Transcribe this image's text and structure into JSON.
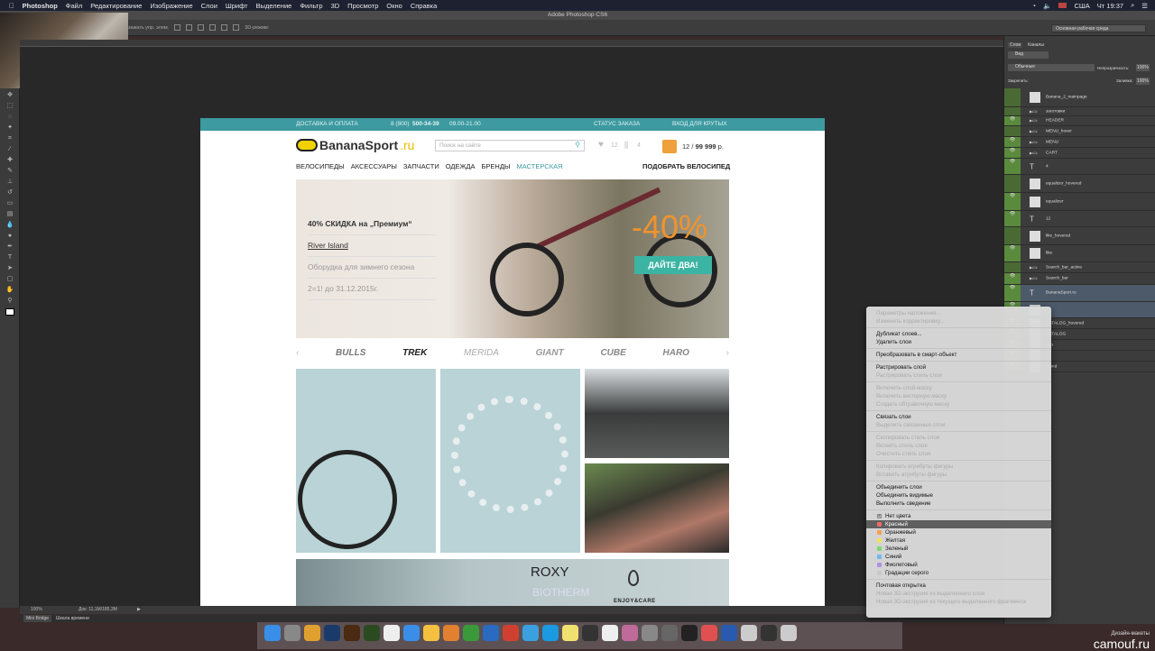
{
  "menubar": {
    "app": "Photoshop",
    "items": [
      "Файл",
      "Редактирование",
      "Изображение",
      "Слои",
      "Шрифт",
      "Выделение",
      "Фильтр",
      "3D",
      "Просмотр",
      "Окно",
      "Справка"
    ],
    "region": "США",
    "clock": "Чт 19:37"
  },
  "window": {
    "title": "Adobe Photoshop CS6",
    "workspace": "Основная рабочая среда",
    "options_label": "зажать упр. элем.",
    "options_3d": "3D-режим:"
  },
  "status": {
    "zoom": "100%",
    "doc": "Док: 11,1M/185,3M",
    "minibridge": "Mini Bridge",
    "timeline": "Шкала времени"
  },
  "site": {
    "topbar": {
      "delivery": "ДОСТАВКА И ОПЛАТА",
      "phone_prefix": "8 (800)",
      "phone": "500-34-39",
      "hours": "09.00-21.00",
      "order_status": "СТАТУС ЗАКАЗА",
      "login": "ВХОД ДЛЯ КРУТЫХ"
    },
    "logo": {
      "name": "BananaSport",
      "tld": ".ru"
    },
    "search_placeholder": "Поиск на сайте",
    "likes": "12",
    "compare": "4",
    "cart": {
      "count": "12",
      "sep": " / ",
      "sum": "99 999",
      "cur": " р."
    },
    "nav": [
      "ВЕЛОСИПЕДЫ",
      "АКСЕССУАРЫ",
      "ЗАПЧАСТИ",
      "ОДЕЖДА",
      "БРЕНДЫ",
      "МАСТЕРСКАЯ"
    ],
    "pick_bike": "ПОДОБРАТЬ ВЕЛОСИПЕД",
    "hero": {
      "items": [
        "40% СКИДКА на „Премиум“",
        "River Island",
        "Оборудка для зимнего сезона",
        "2=1! до 31.12.2015г."
      ],
      "discount": "-40%",
      "cta": "ДАЙТЕ ДВА!"
    },
    "brands": [
      "BULLS",
      "TREK",
      "MERIDA",
      "GIANT",
      "CUBE",
      "HARO"
    ],
    "banner": {
      "brand1": "ROXY",
      "brand2": "BIOTHERM",
      "brand3": "ENJOY&CARE"
    }
  },
  "layers_panel": {
    "tabs": [
      "Слои",
      "Каналы"
    ],
    "filter": "Вид",
    "blend": "Обычные",
    "opacity_label": "Непрозрачность:",
    "opacity": "100%",
    "lock_label": "Закрепить:",
    "fill_label": "Заливка:",
    "fill": "100%",
    "layers": [
      "Banana_2_mainpage",
      "заготовки",
      "HEADER",
      "MENU_hover",
      "MENU",
      "CART",
      "4",
      "equalizer_hovered",
      "equalizer",
      "12",
      "like_hovered",
      "like",
      "Search_bar_active",
      "Search_bar",
      "BananaSport.ru",
      "",
      "CATALOG_hovered",
      "CATALOG",
      "ogo",
      "e",
      "round"
    ]
  },
  "context_menu": {
    "groups": [
      [
        {
          "label": "Параметры наложения...",
          "disabled": true
        },
        {
          "label": "Изменить корректировку...",
          "disabled": true
        }
      ],
      [
        {
          "label": "Дубликат слоев..."
        },
        {
          "label": "Удалить слои"
        }
      ],
      [
        {
          "label": "Преобразовать в смарт-объект"
        }
      ],
      [
        {
          "label": "Растрировать слой"
        },
        {
          "label": "Растрировать стиль слоя",
          "disabled": true
        }
      ],
      [
        {
          "label": "Включить слой-маску",
          "disabled": true
        },
        {
          "label": "Включить векторную маску",
          "disabled": true
        },
        {
          "label": "Создать обтравочную маску",
          "disabled": true
        }
      ],
      [
        {
          "label": "Связать слои"
        },
        {
          "label": "Выделить связанные слои",
          "disabled": true
        }
      ],
      [
        {
          "label": "Скопировать стиль слоя",
          "disabled": true
        },
        {
          "label": "Вклеить стиль слоя",
          "disabled": true
        },
        {
          "label": "Очистить стиль слоя",
          "disabled": true
        }
      ],
      [
        {
          "label": "Копировать атрибуты фигуры",
          "disabled": true
        },
        {
          "label": "Вставить атрибуты фигуры",
          "disabled": true
        }
      ],
      [
        {
          "label": "Объединить слои"
        },
        {
          "label": "Объединить видимые"
        },
        {
          "label": "Выполнить сведение"
        }
      ]
    ],
    "colors": [
      {
        "label": "Нет цвета",
        "color": "none"
      },
      {
        "label": "Красный",
        "color": "#f06a6a",
        "highlighted": true
      },
      {
        "label": "Оранжевый",
        "color": "#f5a050"
      },
      {
        "label": "Желтая",
        "color": "#f0e060"
      },
      {
        "label": "Зеленый",
        "color": "#80d870"
      },
      {
        "label": "Синий",
        "color": "#70b8f0"
      },
      {
        "label": "Фиолетовый",
        "color": "#b090e0"
      },
      {
        "label": "Градации серого",
        "color": "#c8c8c8"
      }
    ],
    "tail": [
      {
        "label": "Почтовая открытка"
      },
      {
        "label": "Новая 3D-экструзия из выделенного слоя",
        "disabled": true
      },
      {
        "label": "Новая 3D-экструзия из текущего выделенного фрагмента",
        "disabled": true
      }
    ]
  },
  "watermark": {
    "small": "Дизайн-макеты",
    "site": "camouf.ru"
  }
}
